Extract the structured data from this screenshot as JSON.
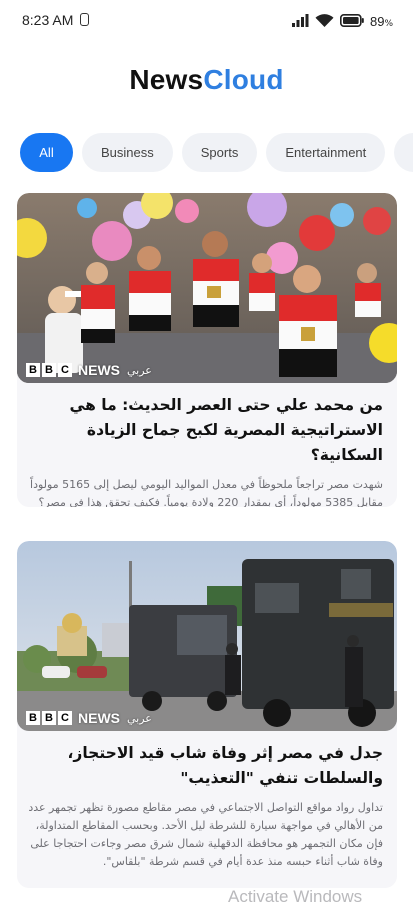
{
  "status_bar": {
    "time": "8:23 AM",
    "battery_pct": "89"
  },
  "app": {
    "title_part1": "News",
    "title_part2": "Cloud",
    "accent_color": "#2f7fe0"
  },
  "tabs": [
    {
      "label": "All",
      "active": true
    },
    {
      "label": "Business",
      "active": false
    },
    {
      "label": "Sports",
      "active": false
    },
    {
      "label": "Entertainment",
      "active": false
    }
  ],
  "articles": [
    {
      "source_logo": "BBC",
      "source_news": "NEWS",
      "source_lang": "عربي",
      "image_desc": "children-with-egyptian-flag-shirts",
      "title": "من محمد علي حتى العصر الحديث: ما هي الاستراتيجية المصرية لكبح جماح الزيادة السكانية؟",
      "summary": "شهدت مصر تراجعاً ملحوظاً في معدل المواليد اليومي ليصل إلى 5165 مولوداً مقابل 5385 مولوداً، أي بمقدار 220 ولادة يومياً. فكيف تحقق هذا في مصر؟ وما هي الدوافع وراء تقليل المصريين للإنجاب؟"
    },
    {
      "source_logo": "BBC",
      "source_news": "NEWS",
      "source_lang": "عربي",
      "image_desc": "egyptian-police-trucks",
      "title": "جدل في مصر إثر وفاة شاب قيد الاحتجاز، والسلطات تنفي \"التعذيب\"",
      "summary": "تداول رواد مواقع التواصل الاجتماعي في مصر مقاطع مصورة تظهر تجمهر عدد من الأهالي في مواجهة سيارة للشرطة ليل الأحد. وبحسب المقاطع المتداولة، فإن مكان التجمهر هو محافظة الدقهلية شمال شرق مصر وجاءت احتجاجا على وفاة شاب أثناء حبسه منذ عدة أيام في قسم شرطة \"بلقاس\"."
    }
  ],
  "watermark": "Activate Windows"
}
